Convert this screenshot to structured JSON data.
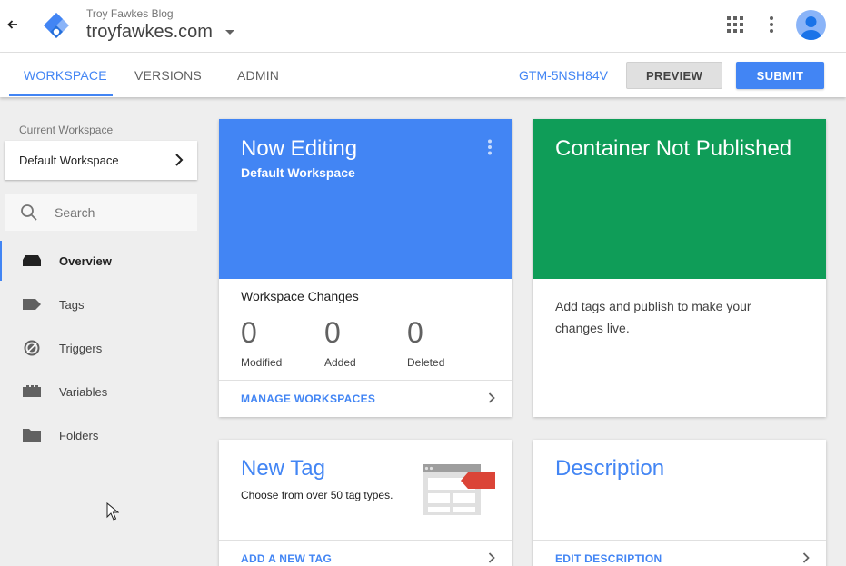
{
  "header": {
    "account_name": "Troy Fawkes Blog",
    "container_name": "troyfawkes.com"
  },
  "tabs": [
    {
      "label": "WORKSPACE"
    },
    {
      "label": "VERSIONS"
    },
    {
      "label": "ADMIN"
    }
  ],
  "toolbar": {
    "container_id": "GTM-5NSH84V",
    "preview_label": "PREVIEW",
    "submit_label": "SUBMIT"
  },
  "sidebar": {
    "current_workspace_label": "Current Workspace",
    "workspace_name": "Default Workspace",
    "search_placeholder": "Search",
    "items": [
      {
        "label": "Overview",
        "icon": "overview-icon"
      },
      {
        "label": "Tags",
        "icon": "tag-icon"
      },
      {
        "label": "Triggers",
        "icon": "trigger-icon"
      },
      {
        "label": "Variables",
        "icon": "variables-icon"
      },
      {
        "label": "Folders",
        "icon": "folder-icon"
      }
    ]
  },
  "cards": {
    "now_editing": {
      "title": "Now Editing",
      "subtitle": "Default Workspace",
      "changes_title": "Workspace Changes",
      "stats": [
        {
          "value": "0",
          "label": "Modified"
        },
        {
          "value": "0",
          "label": "Added"
        },
        {
          "value": "0",
          "label": "Deleted"
        }
      ],
      "link": "MANAGE WORKSPACES"
    },
    "container_status": {
      "title": "Container Not Published",
      "body": "Add tags and publish to make your changes live."
    },
    "new_tag": {
      "title": "New Tag",
      "body": "Choose from over 50 tag types.",
      "link": "ADD A NEW TAG"
    },
    "description": {
      "title": "Description",
      "link": "EDIT DESCRIPTION"
    }
  },
  "colors": {
    "accent": "#4285f4",
    "published_green": "#0f9d58",
    "tag_red": "#db4437"
  }
}
